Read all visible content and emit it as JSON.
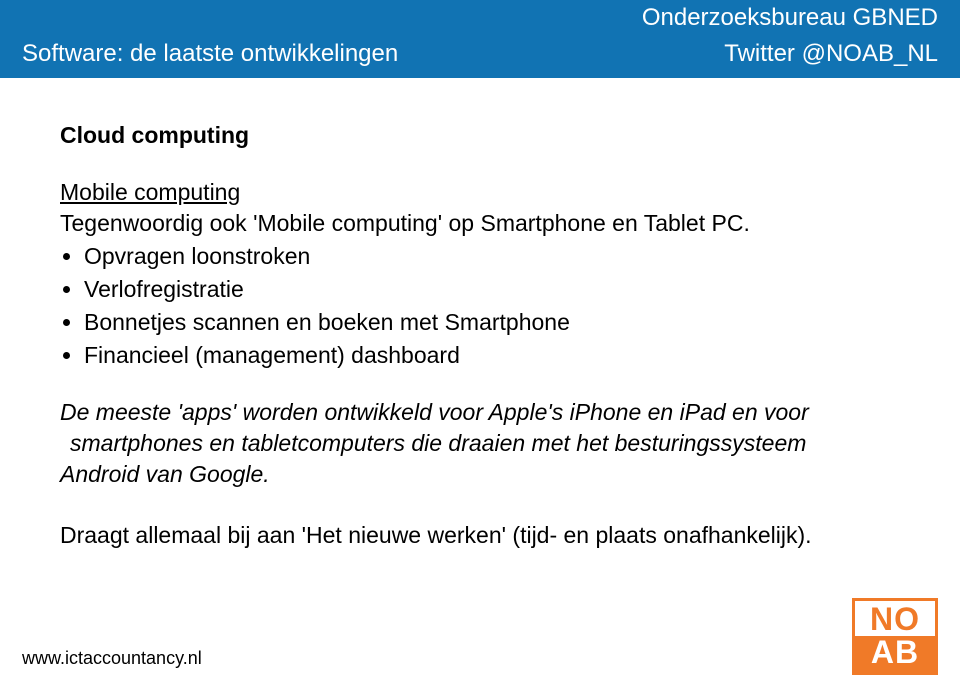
{
  "header": {
    "org": "Onderzoeksbureau GBNED",
    "title_left": "Software: de laatste ontwikkelingen",
    "twitter": "Twitter @NOAB_NL"
  },
  "content": {
    "heading": "Cloud computing",
    "mobile_title": "Mobile computing",
    "mobile_intro": "Tegenwoordig ook 'Mobile computing' op Smartphone en Tablet PC.",
    "bullets": [
      "Opvragen loonstroken",
      "Verlofregistratie",
      "Bonnetjes scannen en boeken met Smartphone",
      "Financieel (management) dashboard"
    ],
    "italic_line1": "De meeste 'apps' worden ontwikkeld voor Apple's iPhone en iPad en voor",
    "italic_line2": "smartphones en tabletcomputers die draaien met het besturingssysteem",
    "italic_line3": "Android van Google.",
    "conclusion": "Draagt allemaal bij aan 'Het nieuwe werken' (tijd- en plaats onafhankelijk)."
  },
  "footer": {
    "url": "www.ictaccountancy.nl"
  },
  "logo": {
    "top": "NO",
    "bottom": "AB"
  }
}
